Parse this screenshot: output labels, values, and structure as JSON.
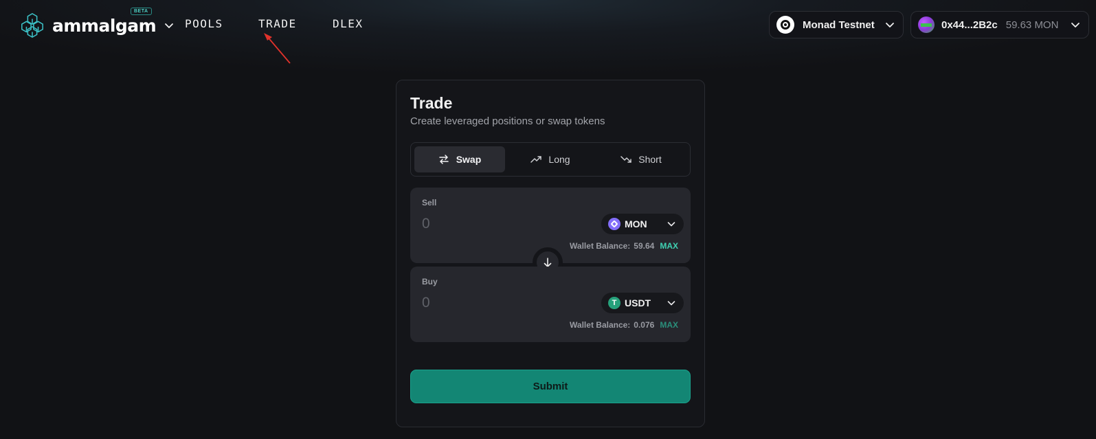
{
  "header": {
    "brand": "ammalgam",
    "beta_badge": "BETA",
    "nav": {
      "pools": "POOLS",
      "trade": "TRADE",
      "dlex": "DLEX"
    },
    "network": {
      "label": "Monad Testnet",
      "icon": "monad-icon"
    },
    "wallet": {
      "address": "0x44...2B2c",
      "balance": "59.63 MON",
      "icon": "avatar"
    }
  },
  "trade": {
    "title": "Trade",
    "subtitle": "Create leveraged positions or swap tokens",
    "tabs": [
      {
        "label": "Swap",
        "icon": "swap-icon",
        "active": true
      },
      {
        "label": "Long",
        "icon": "trend-up-icon",
        "active": false
      },
      {
        "label": "Short",
        "icon": "trend-down-icon",
        "active": false
      }
    ],
    "sell": {
      "label": "Sell",
      "placeholder": "0",
      "token": "MON",
      "balance_label": "Wallet Balance:",
      "balance_value": "59.64",
      "max_label": "MAX"
    },
    "buy": {
      "label": "Buy",
      "placeholder": "0",
      "token": "USDT",
      "token_icon_glyph": "T",
      "balance_label": "Wallet Balance:",
      "balance_value": "0.076",
      "max_label": "MAX"
    },
    "submit_label": "Submit"
  },
  "colors": {
    "background": "#111215",
    "accent": "#138674",
    "max_link": "#3fd1b2",
    "annotation_arrow": "#e0322b"
  }
}
